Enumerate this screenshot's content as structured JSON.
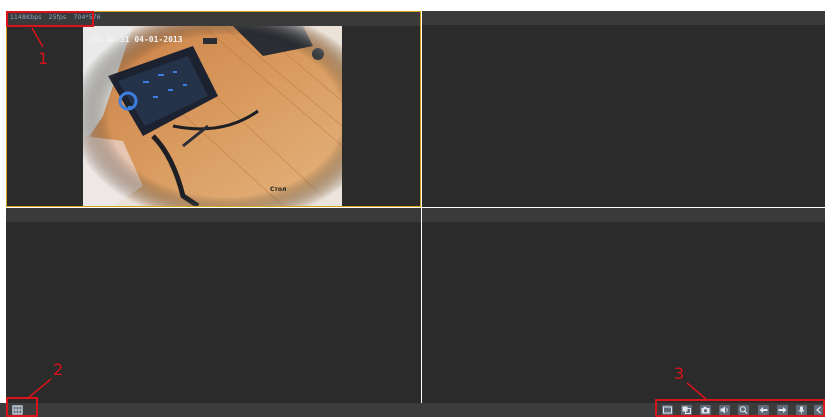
{
  "viewer": {
    "pane1": {
      "bitrate": "1148Kbps",
      "fps": "25fps",
      "resolution": "704*576",
      "timestamp": "20:06:31 04-01-2013",
      "camera_label": "Стол"
    }
  },
  "toolbar": {
    "left_button_icon": "layout-grid-icon",
    "right_buttons": [
      {
        "name": "fullscreen-button",
        "icon": "fullscreen-icon"
      },
      {
        "name": "record-button",
        "icon": "record-icon"
      },
      {
        "name": "snapshot-button",
        "icon": "camera-icon"
      },
      {
        "name": "audio-button",
        "icon": "speaker-icon"
      },
      {
        "name": "zoom-button",
        "icon": "zoom-icon"
      },
      {
        "name": "previous-button",
        "icon": "arrow-left-icon"
      },
      {
        "name": "next-button",
        "icon": "arrow-right-icon"
      },
      {
        "name": "microphone-button",
        "icon": "microphone-icon"
      },
      {
        "name": "more-button",
        "icon": "more-icon"
      }
    ]
  },
  "annotations": {
    "label_1": "1",
    "label_2": "2",
    "label_3": "3"
  },
  "colors": {
    "pane_bg": "#2b2b2b",
    "active_border": "#d4a017",
    "annotation": "#d9121b",
    "toolbar_bg": "#3c3c3c"
  }
}
